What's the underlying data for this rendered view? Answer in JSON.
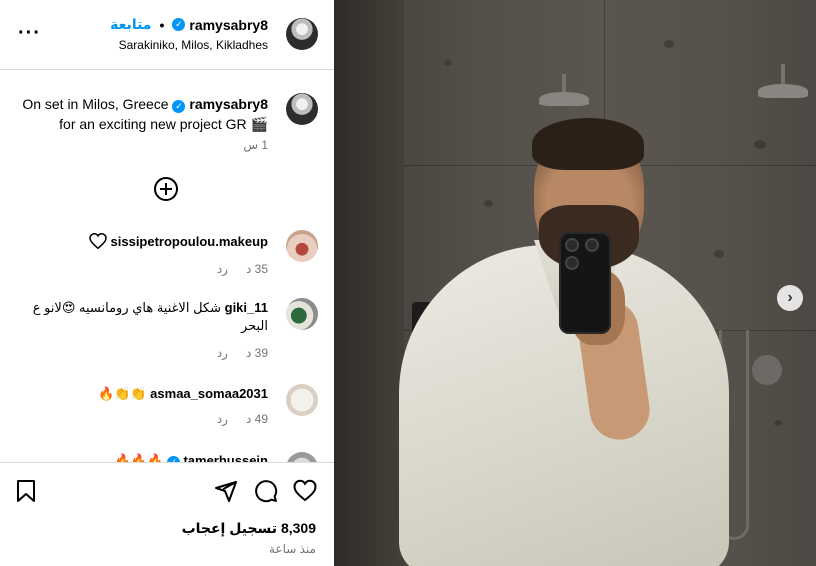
{
  "header": {
    "username": "ramysabry8",
    "verified": true,
    "follow_label": "متابعة",
    "location": "Sarakiniko, Milos, Kikladhes",
    "more_icon": "more-horizontal-icon"
  },
  "caption": {
    "username": "ramysabry8",
    "text_line1": "On set in Milos, Greece",
    "text_line2": "for an exciting new project GR 🎬",
    "time": "1 س"
  },
  "add_comment_icon": "plus-circle-icon",
  "comments": [
    {
      "username": "sissipetropoulou.makeup",
      "text": "",
      "has_heart_icon": true,
      "time": "35 د",
      "reply": "رد"
    },
    {
      "username": "giki_11",
      "text": "شكل الاغنية هاي رومانسيه 😍لانو ع البحر",
      "time": "39 د",
      "reply": "رد"
    },
    {
      "username": "asmaa_somaa2031",
      "text": "👏👏🔥",
      "time": "49 د",
      "reply": "رد"
    },
    {
      "username": "tamerhussein",
      "text": "🔥🔥🔥",
      "verified": true
    }
  ],
  "actions": {
    "like_icon": "heart-icon",
    "comment_icon": "comment-icon",
    "share_icon": "send-icon",
    "save_icon": "bookmark-icon"
  },
  "likes": "8,309 تسجيل إعجاب",
  "since": "منذ ساعة",
  "photo": {
    "next_icon": "chevron-right-icon"
  },
  "colors": {
    "accent": "#0095f6",
    "muted": "#737373",
    "border": "#dbdbdb"
  }
}
